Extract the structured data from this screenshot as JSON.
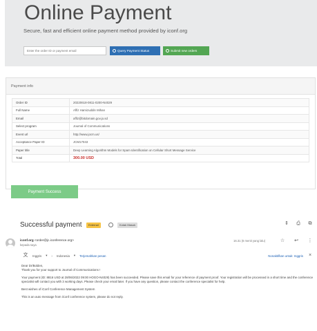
{
  "hero": {
    "title": "Online Payment",
    "subtitle": "Secure, fast and efficient online payment method provided by iconf.org",
    "input_placeholder": "Enter the order ID or payment email",
    "query_button": "Query Payment Status",
    "submit_button": "Submit new orders",
    "colors": {
      "query": "#2e6fb3",
      "submit": "#53a653"
    }
  },
  "payment_info": {
    "header": "Payment info",
    "rows": [
      {
        "label": "Order ID",
        "value": "20220618-0811-0200-N4029"
      },
      {
        "label": "Full Name",
        "value": "Affiz Hamizuddin Mihan"
      },
      {
        "label": "Email",
        "value": "affiz@bitdomain.gov.jo.sd"
      },
      {
        "label": "Select program",
        "value": "Journal of Communications"
      },
      {
        "label": "Event url",
        "value": "http://www.jocm.us/"
      },
      {
        "label": "Acceptance Paper ID",
        "value": "JCM17043"
      },
      {
        "label": "Paper title",
        "value": "Deep Learning Algorithm Models for Spam Identification on Cellular Short Message Service"
      },
      {
        "label": "Total",
        "value": "300.00 USD"
      }
    ],
    "amount_color": "#c9302c",
    "success_button": "Payment Success"
  },
  "email": {
    "subject": "Successful payment",
    "badge_external": "External",
    "badge_inbox": "Kotak Masuk",
    "sender_name": "iconf.org",
    "sender_address": "<order@jc.iconference.org>",
    "recipient": "kepada saya",
    "date": "16.31 (6 menit yang lalu)",
    "translate": {
      "from": "Inggris",
      "to": "Indonesia",
      "action": "Terjemahkan pesan",
      "disable": "Nonaktifkan untuk: Inggris"
    },
    "body": {
      "greeting": "Dear Dr/Bolden,",
      "thanks": "Thank you for your support to Journal of Communications !",
      "paragraph": "Your payment (ID: 8816 USD at 28/06/2022 09:00 HOGO-N4029) has been succeeded. Please save this email for your reference of payment proof. Your registration will be processed in a short time and the conference specialist will contact you with 3 working days. Please check your email later. If you have any question, please contact the conference specialist for help.",
      "regards": "Best wishes of iConf Conference Management System",
      "note": "This is an auto message from iConf conference system, please do not reply."
    }
  }
}
